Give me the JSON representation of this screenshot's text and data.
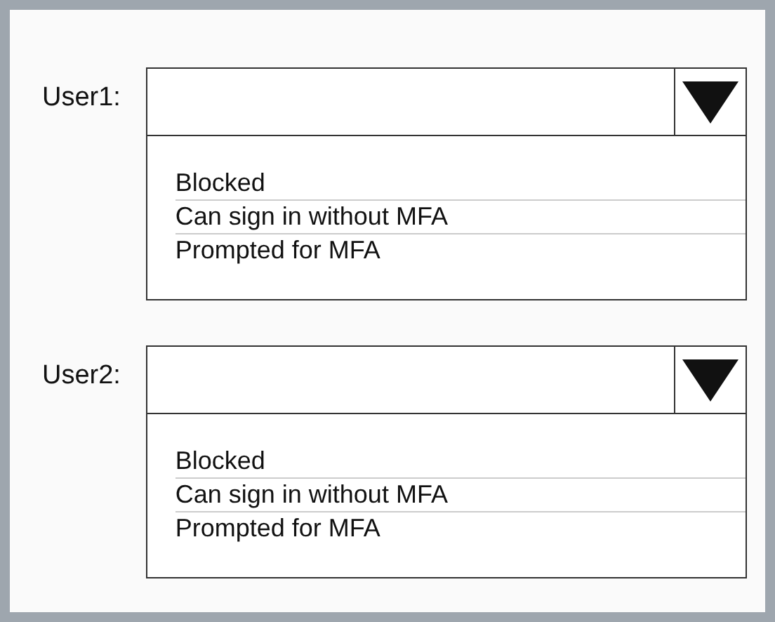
{
  "dropdowns": [
    {
      "label": "User1:",
      "options": [
        "Blocked",
        "Can sign in without MFA",
        "Prompted for MFA"
      ]
    },
    {
      "label": "User2:",
      "options": [
        "Blocked",
        "Can sign in without MFA",
        "Prompted for MFA"
      ]
    }
  ]
}
